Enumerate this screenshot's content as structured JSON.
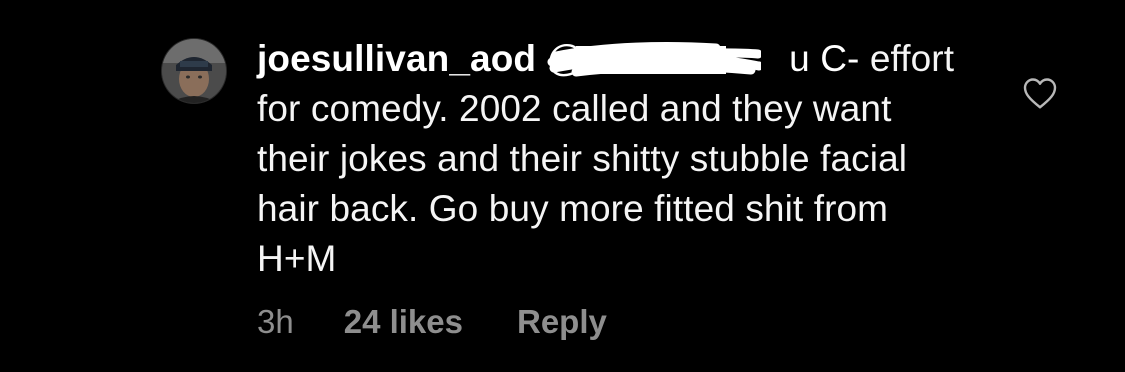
{
  "comment": {
    "username": "joesullivan_aod",
    "mention": "@",
    "mention_tail": "u C-",
    "text": "effort for comedy. 2002 called and they want their jokes and their shitty stubble facial hair back. Go buy more fitted shit from H+M",
    "time": "3h",
    "likes": "24 likes",
    "reply_label": "Reply",
    "liked": false,
    "avatar_icon": "user-avatar-photo",
    "like_icon": "heart-outline-icon"
  },
  "colors": {
    "background": "#000000",
    "text": "#ffffff",
    "meta": "#8e8e8e"
  }
}
